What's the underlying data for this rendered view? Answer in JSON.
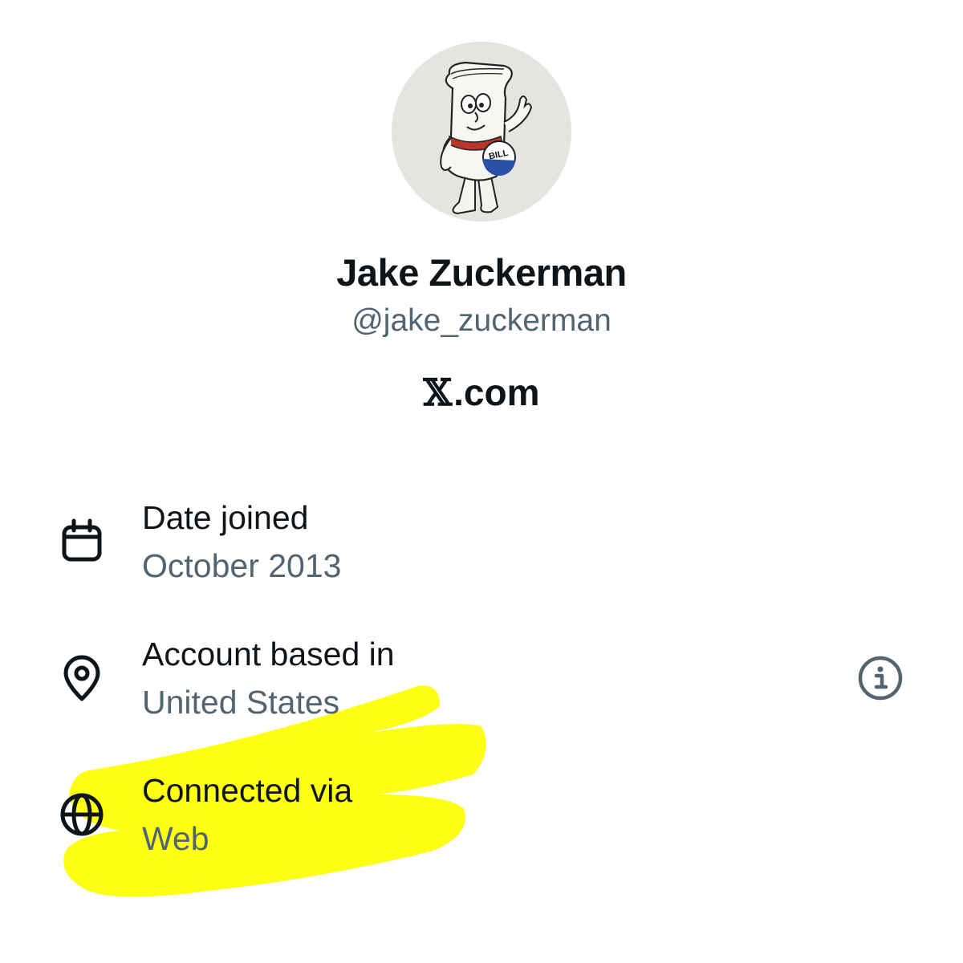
{
  "profile": {
    "display_name": "Jake Zuckerman",
    "handle": "@jake_zuckerman",
    "avatar_badge_text": "BILL"
  },
  "site": {
    "mark": "𝕏",
    "domain": ".com"
  },
  "details": [
    {
      "icon": "calendar-icon",
      "label": "Date joined",
      "value": "October 2013"
    },
    {
      "icon": "location-pin-icon",
      "label": "Account based in",
      "value": "United States"
    },
    {
      "icon": "globe-icon",
      "label": "Connected via",
      "value": "Web"
    }
  ],
  "colors": {
    "text_primary": "#0f1419",
    "text_secondary": "#536471",
    "highlight": "#ffff00"
  }
}
